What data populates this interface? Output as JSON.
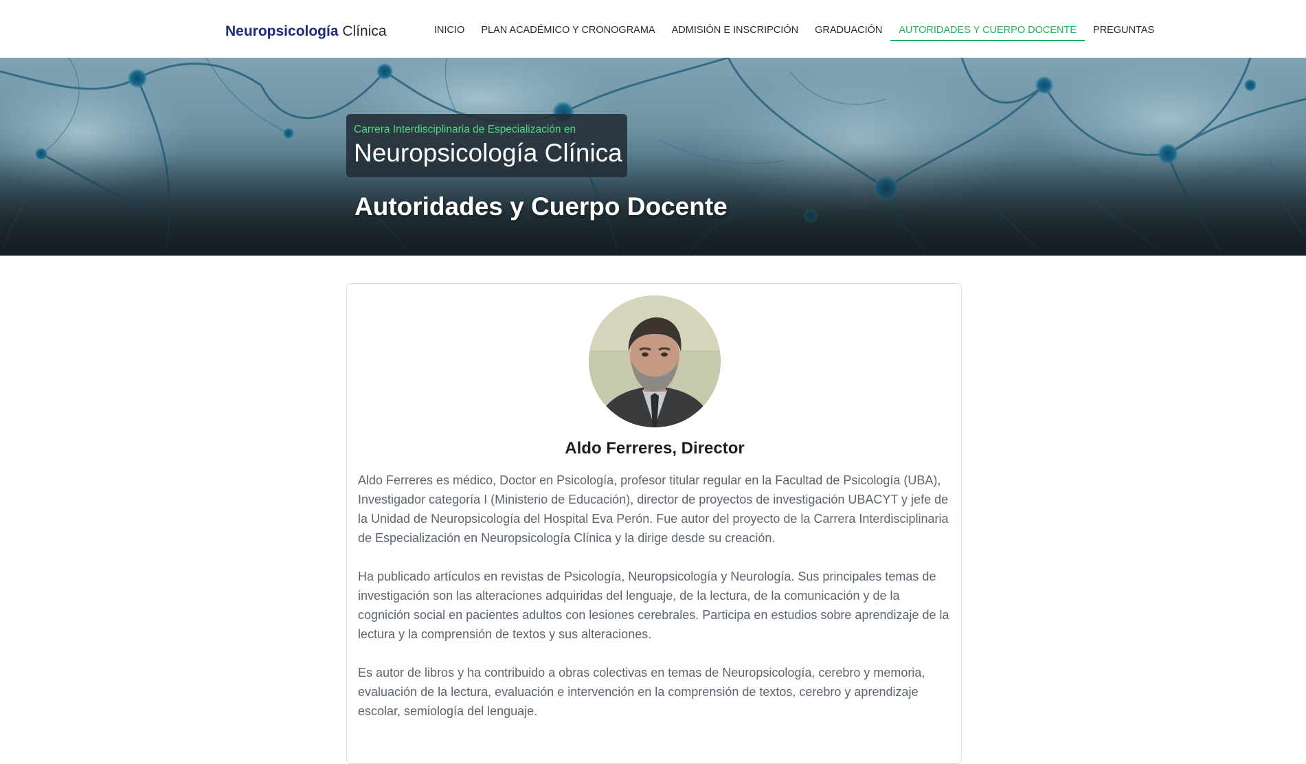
{
  "brand": {
    "bold": "Neuropsicología",
    "light": "Clínica"
  },
  "nav": {
    "items": [
      {
        "label": "INICIO"
      },
      {
        "label": "PLAN ACADÉMICO Y CRONOGRAMA"
      },
      {
        "label": "ADMISIÓN E INSCRIPCIÓN"
      },
      {
        "label": "GRADUACIÓN"
      },
      {
        "label": "AUTORIDADES Y CUERPO DOCENTE"
      },
      {
        "label": "PREGUNTAS"
      }
    ],
    "active_index": 4
  },
  "hero": {
    "kicker": "Carrera Interdisciplinaria de Especialización en",
    "title": "Neuropsicología Clínica",
    "heading": "Autoridades y Cuerpo Docente"
  },
  "profile": {
    "name": "Aldo Ferreres, Director",
    "bio": [
      "Aldo Ferreres es médico, Doctor en Psicología, profesor titular regular en la Facultad de Psicología (UBA), Investigador categoría I (Ministerio de Educación), director de proyectos de investigación UBACYT y jefe de la Unidad de Neuropsicología del Hospital Eva Perón. Fue autor del proyecto de la Carrera Interdisciplinaria de Especialización en Neuropsicología Clínica y la dirige desde su creación.",
      "Ha publicado artículos en revistas de Psicología, Neuropsicología y Neurología. Sus principales temas de investigación son las alteraciones adquiridas del lenguaje, de la lectura, de la comunicación y de la cognición social en pacientes adultos con lesiones cerebrales. Participa en estudios sobre aprendizaje de la lectura y la comprensión de textos y sus alteraciones.",
      "Es autor de libros y ha contribuido a obras colectivas en temas de Neuropsicología, cerebro y memoria, evaluación de la lectura, evaluación e intervención en la comprensión de textos, cerebro y aprendizaje escolar, semiología del lenguaje."
    ]
  },
  "colors": {
    "brand_blue": "#1b2a7a",
    "accent_green": "#22b35e",
    "kicker_green": "#4ddb82",
    "body_text": "#5b6470"
  }
}
